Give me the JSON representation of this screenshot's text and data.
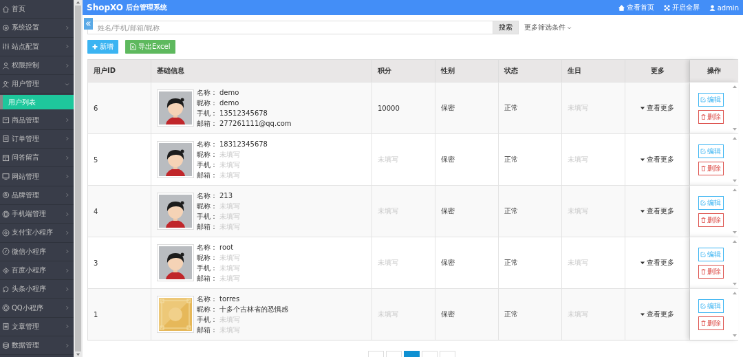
{
  "sidebar": {
    "items": [
      {
        "label": "首页",
        "has_arrow": false
      },
      {
        "label": "系统设置",
        "has_arrow": true,
        "expanded": false
      },
      {
        "label": "站点配置",
        "has_arrow": true,
        "expanded": false
      },
      {
        "label": "权限控制",
        "has_arrow": true,
        "expanded": false
      },
      {
        "label": "用户管理",
        "has_arrow": true,
        "expanded": true,
        "children": [
          {
            "label": "用户列表",
            "selected": true
          }
        ]
      },
      {
        "label": "商品管理",
        "has_arrow": true,
        "expanded": false
      },
      {
        "label": "订单管理",
        "has_arrow": true,
        "expanded": false
      },
      {
        "label": "问答留言",
        "has_arrow": true,
        "expanded": false
      },
      {
        "label": "网站管理",
        "has_arrow": true,
        "expanded": false
      },
      {
        "label": "品牌管理",
        "has_arrow": true,
        "expanded": false
      },
      {
        "label": "手机端管理",
        "has_arrow": true,
        "expanded": false
      },
      {
        "label": "支付宝小程序",
        "has_arrow": true,
        "expanded": false
      },
      {
        "label": "微信小程序",
        "has_arrow": true,
        "expanded": false
      },
      {
        "label": "百度小程序",
        "has_arrow": true,
        "expanded": false
      },
      {
        "label": "头条小程序",
        "has_arrow": true,
        "expanded": false
      },
      {
        "label": "QQ小程序",
        "has_arrow": true,
        "expanded": false
      },
      {
        "label": "文章管理",
        "has_arrow": true,
        "expanded": false
      },
      {
        "label": "数据管理",
        "has_arrow": true,
        "expanded": false
      }
    ]
  },
  "header": {
    "brand": "ShopXO",
    "subtitle": "后台管理系统",
    "links": [
      {
        "kind": "home",
        "label": "查看首页"
      },
      {
        "kind": "fullscreen",
        "label": "开启全屏"
      },
      {
        "kind": "user",
        "label": "admin"
      }
    ]
  },
  "search": {
    "placeholder": "姓名/手机/邮箱/昵称",
    "button": "搜索",
    "more_filters": "更多筛选条件"
  },
  "actions": [
    {
      "kind": "add",
      "label": "新增"
    },
    {
      "kind": "export",
      "label": "导出Excel"
    }
  ],
  "table": {
    "columns": [
      "用户ID",
      "基础信息",
      "积分",
      "性别",
      "状态",
      "生日",
      "更多",
      "操作"
    ],
    "rows": [
      {
        "id": "6",
        "avatar": {
          "kind": "cartoon"
        },
        "info": [
          {
            "label": "名称：",
            "value": "demo",
            "empty": false
          },
          {
            "label": "昵称：",
            "value": "demo",
            "empty": false
          },
          {
            "label": "手机：",
            "value": "13512345678",
            "empty": false
          },
          {
            "label": "邮箱：",
            "value": "277261111@qq.com",
            "empty": false
          }
        ],
        "points": {
          "text": "10000",
          "empty": false
        },
        "gender": "保密",
        "status": "正常",
        "birthday": {
          "text": "未填写",
          "empty": true
        },
        "more": "查看更多",
        "edit": "编辑",
        "delete": "删除"
      },
      {
        "id": "5",
        "avatar": {
          "kind": "cartoon"
        },
        "info": [
          {
            "label": "名称：",
            "value": "18312345678",
            "empty": false
          },
          {
            "label": "昵称：",
            "value": "未填写",
            "empty": true
          },
          {
            "label": "手机：",
            "value": "未填写",
            "empty": true
          },
          {
            "label": "邮箱：",
            "value": "未填写",
            "empty": true
          }
        ],
        "points": {
          "text": "未填写",
          "empty": true
        },
        "gender": "保密",
        "status": "正常",
        "birthday": {
          "text": "未填写",
          "empty": true
        },
        "more": "查看更多",
        "edit": "编辑",
        "delete": "删除"
      },
      {
        "id": "4",
        "avatar": {
          "kind": "cartoon"
        },
        "info": [
          {
            "label": "名称：",
            "value": "213",
            "empty": false
          },
          {
            "label": "昵称：",
            "value": "未填写",
            "empty": true
          },
          {
            "label": "手机：",
            "value": "未填写",
            "empty": true
          },
          {
            "label": "邮箱：",
            "value": "未填写",
            "empty": true
          }
        ],
        "points": {
          "text": "未填写",
          "empty": true
        },
        "gender": "保密",
        "status": "正常",
        "birthday": {
          "text": "未填写",
          "empty": true
        },
        "more": "查看更多",
        "edit": "编辑",
        "delete": "删除"
      },
      {
        "id": "3",
        "avatar": {
          "kind": "cartoon"
        },
        "info": [
          {
            "label": "名称：",
            "value": "root",
            "empty": false
          },
          {
            "label": "昵称：",
            "value": "未填写",
            "empty": true
          },
          {
            "label": "手机：",
            "value": "未填写",
            "empty": true
          },
          {
            "label": "邮箱：",
            "value": "未填写",
            "empty": true
          }
        ],
        "points": {
          "text": "未填写",
          "empty": true
        },
        "gender": "保密",
        "status": "正常",
        "birthday": {
          "text": "未填写",
          "empty": true
        },
        "more": "查看更多",
        "edit": "编辑",
        "delete": "删除"
      },
      {
        "id": "1",
        "avatar": {
          "kind": "tile"
        },
        "info": [
          {
            "label": "名称：",
            "value": "torres",
            "empty": false
          },
          {
            "label": "昵称：",
            "value": "十多个吉林省的恐惧感",
            "empty": false
          },
          {
            "label": "手机：",
            "value": "未填写",
            "empty": true
          },
          {
            "label": "邮箱：",
            "value": "未填写",
            "empty": true
          }
        ],
        "points": {
          "text": "未填写",
          "empty": true
        },
        "gender": "保密",
        "status": "正常",
        "birthday": {
          "text": "未填写",
          "empty": true
        },
        "more": "查看更多",
        "edit": "编辑",
        "delete": "删除"
      }
    ]
  },
  "pagination": [
    {
      "selected": false
    },
    {
      "selected": false
    },
    {
      "selected": true
    },
    {
      "selected": false
    },
    {
      "selected": false
    }
  ]
}
